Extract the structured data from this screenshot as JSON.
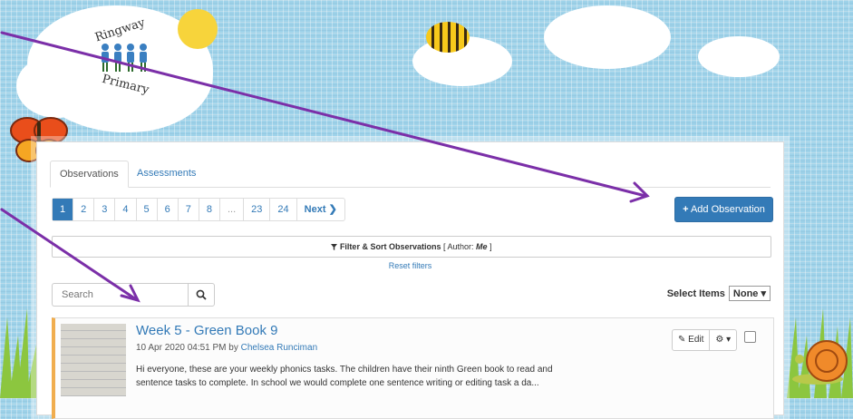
{
  "logo": {
    "name_top": "Ringway",
    "name_bottom": "Primary"
  },
  "tabs": [
    {
      "label": "Observations",
      "active": true
    },
    {
      "label": "Assessments",
      "active": false
    }
  ],
  "pagination": {
    "pages": [
      "1",
      "2",
      "3",
      "4",
      "5",
      "6",
      "7",
      "8",
      "...",
      "23",
      "24"
    ],
    "current": "1",
    "next_label": "Next"
  },
  "add_button": {
    "label": "Add Observation",
    "icon": "plus-icon"
  },
  "filter": {
    "label": "Filter & Sort Observations",
    "author_prefix": "[ Author:",
    "author_value": "Me",
    "author_suffix": "]",
    "icon": "funnel-icon",
    "reset_label": "Reset filters"
  },
  "search": {
    "placeholder": "Search",
    "icon": "search-icon"
  },
  "select_items": {
    "label": "Select Items",
    "value": "None"
  },
  "observation": {
    "title": "Week 5 - Green Book 9",
    "date": "10 Apr 2020 04:51 PM by",
    "author": "Chelsea Runciman",
    "description": "Hi everyone, these are your weekly phonics tasks. The children have their ninth Green book to read and sentence tasks to complete. In school we would complete one sentence writing or editing task a da...",
    "edit_label": "Edit",
    "edit_icon": "pencil-icon",
    "settings_icon": "gear-icon"
  },
  "colors": {
    "accent": "#337ab7",
    "annotation_arrow": "#7b2fa8",
    "card_accent": "#f0ad4e"
  }
}
